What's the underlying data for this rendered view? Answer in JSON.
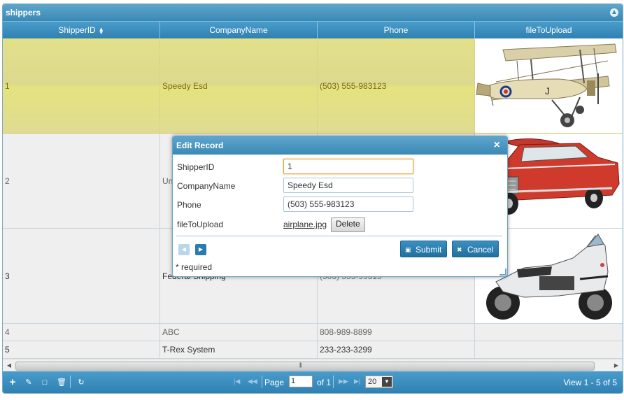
{
  "grid": {
    "caption": "shippers",
    "columns": [
      {
        "label": "ShipperID",
        "sorted": true
      },
      {
        "label": "CompanyName"
      },
      {
        "label": "Phone"
      },
      {
        "label": "fileToUpload"
      }
    ],
    "rows": [
      {
        "id": "1",
        "company": "Speedy Esd",
        "phone": "(503) 555-983123",
        "image": "airplane"
      },
      {
        "id": "2",
        "company": "Un",
        "phone": "",
        "image": "car"
      },
      {
        "id": "3",
        "company": "Federal Shipping",
        "phone": "(503) 555-99315",
        "image": "motorcycle"
      },
      {
        "id": "4",
        "company": "ABC",
        "phone": "808-989-8899",
        "image": ""
      },
      {
        "id": "5",
        "company": "T-Rex System",
        "phone": "233-233-3299",
        "image": ""
      }
    ]
  },
  "pager": {
    "page_label": "Page",
    "page_value": "1",
    "of_label": "of 1",
    "rows_per_page": "20",
    "view_info": "View 1 - 5 of 5"
  },
  "dialog": {
    "title": "Edit Record",
    "fields": [
      {
        "label": "ShipperID",
        "value": "1"
      },
      {
        "label": "CompanyName",
        "value": "Speedy Esd"
      },
      {
        "label": "Phone",
        "value": "(503) 555-983123"
      },
      {
        "label": "fileToUpload",
        "file": "airplane.jpg",
        "delete_label": "Delete"
      }
    ],
    "submit_label": "Submit",
    "cancel_label": "Cancel",
    "required_note": "* required"
  },
  "colors": {
    "header": "#3a89b6",
    "selected_row": "#e3e08a",
    "accent": "#e8a540"
  }
}
